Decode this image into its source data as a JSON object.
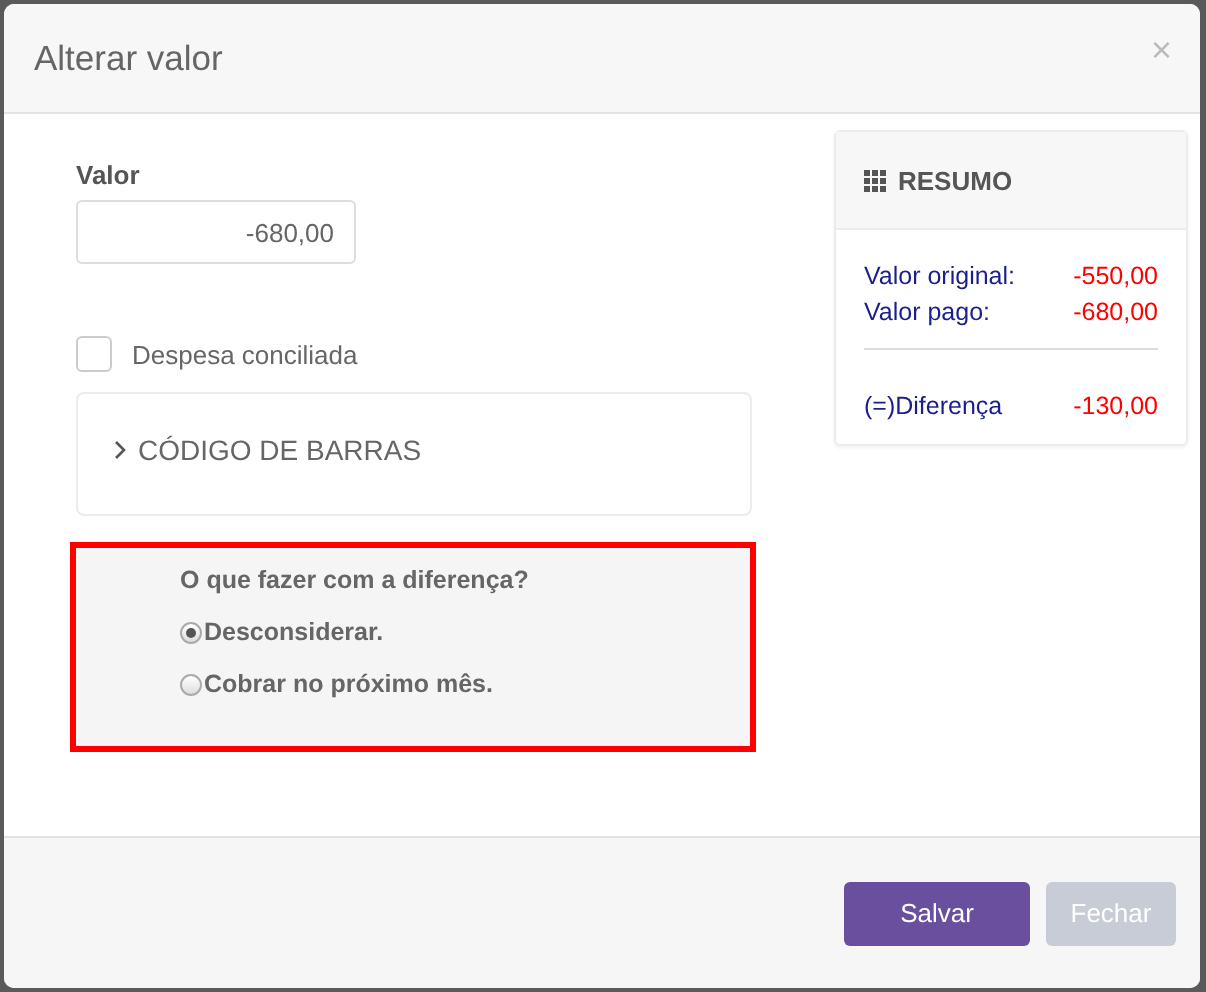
{
  "dialog": {
    "title": "Alterar valor",
    "close": "×"
  },
  "form": {
    "value_label": "Valor",
    "value": "-680,00",
    "checkbox": {
      "label": "Despesa conciliada",
      "checked": false
    },
    "collapsible": {
      "label": "CÓDIGO DE BARRAS",
      "expanded": false
    }
  },
  "difference": {
    "question": "O que fazer com a diferença?",
    "options": [
      {
        "label": "Desconsiderar.",
        "selected": true
      },
      {
        "label": "Cobrar no próximo mês.",
        "selected": false
      }
    ]
  },
  "summary": {
    "title": "RESUMO",
    "rows": [
      {
        "kind": "line",
        "label": "Valor original:",
        "value": "-550,00"
      },
      {
        "kind": "line",
        "label": "Valor pago:",
        "value": "-680,00"
      },
      {
        "kind": "total",
        "label": "(=)Diferença",
        "value": "-130,00"
      }
    ]
  },
  "buttons": [
    {
      "kind": "primary",
      "label": "Salvar",
      "disabled": false
    },
    {
      "kind": "secondary",
      "label": "Fechar",
      "disabled": true
    }
  ]
}
